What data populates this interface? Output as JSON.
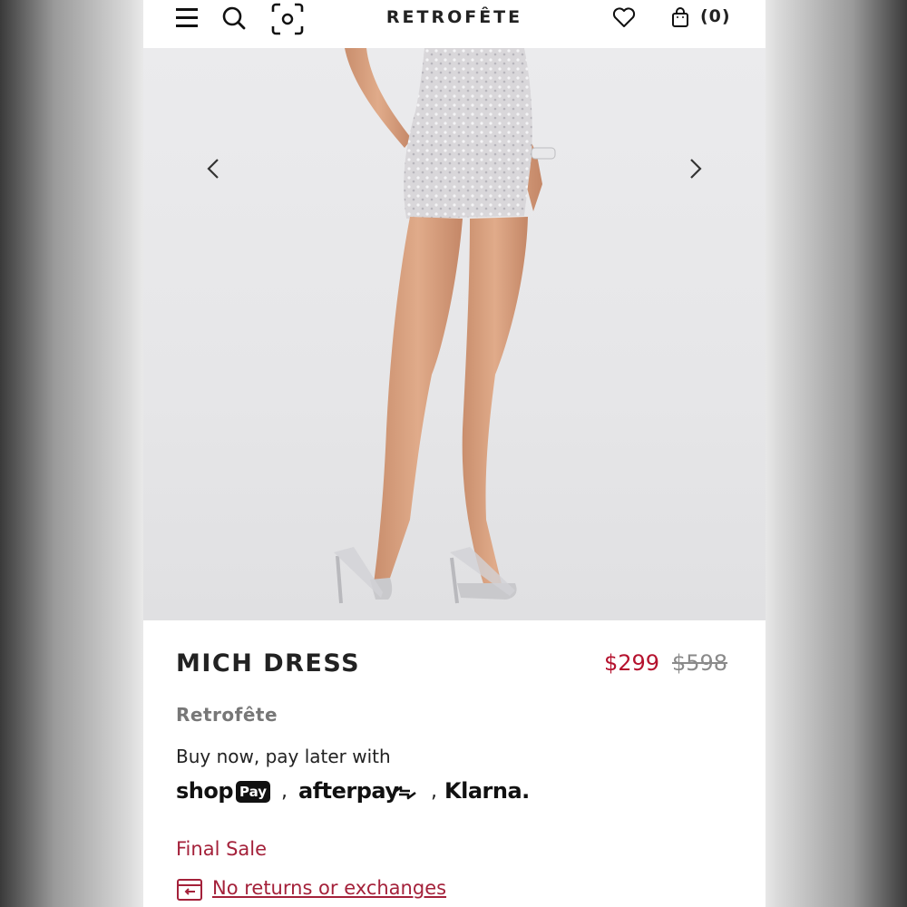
{
  "header": {
    "logo": "RETROFÊTE",
    "cart_count": "(0)",
    "icons": [
      "menu-icon",
      "search-icon",
      "visual-search-icon",
      "heart-icon",
      "shopping-bag-icon"
    ]
  },
  "gallery": {
    "prev_icon": "chevron-left-icon",
    "next_icon": "chevron-right-icon",
    "image": "product-photo-model-legs-sequin-mini-dress"
  },
  "product": {
    "title": "MICH DRESS",
    "sale_price": "$299",
    "original_price": "$598",
    "brand": "Retrofête",
    "pay_later_text": "Buy now, pay later with",
    "payment": {
      "shop": "shop",
      "pay_badge": "Pay",
      "sep": ",",
      "afterpay": "afterpay",
      "klarna": "Klarna."
    },
    "final_sale": "Final Sale",
    "returns_link": "No returns or exchanges"
  },
  "colors": {
    "sale_red": "#b5122e",
    "link_red": "#a4213a",
    "text_dark": "#222222",
    "muted": "#777777"
  }
}
